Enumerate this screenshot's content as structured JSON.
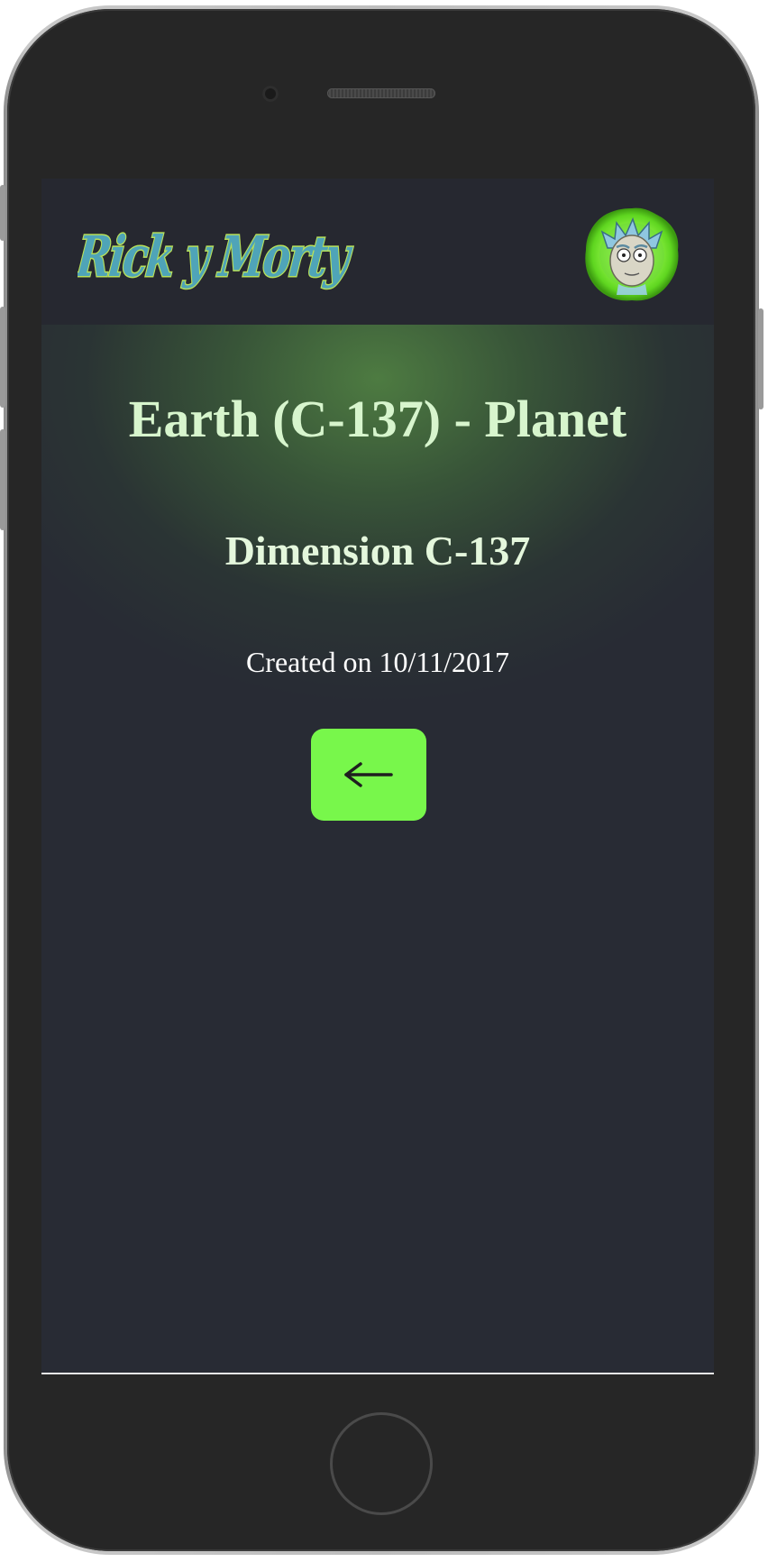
{
  "header": {
    "logo_text": "Rick y Morty",
    "avatar_icon": "rick-portal-avatar"
  },
  "location": {
    "title": "Earth (C-137) - Planet",
    "dimension": "Dimension C-137",
    "created": "Created on 10/11/2017"
  },
  "actions": {
    "back_icon": "arrow-left-icon",
    "back_label": "←"
  },
  "colors": {
    "accent": "#78f74b",
    "title_text": "#d7f5cd",
    "background": "#282b34",
    "logo_text": "#4fa4b8",
    "logo_outline": "#b7e05a"
  }
}
